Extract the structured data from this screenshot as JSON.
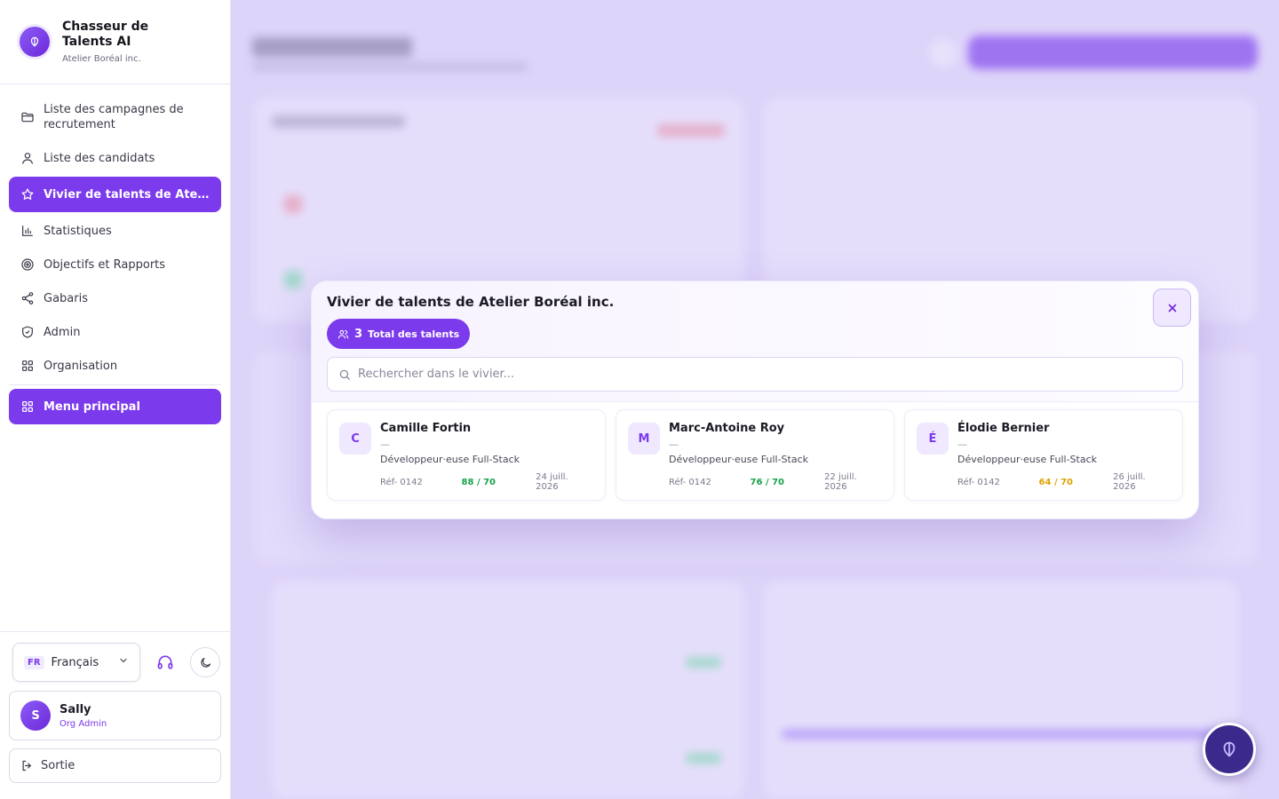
{
  "brand": {
    "title": "Chasseur de Talents AI",
    "subtitle": "Atelier Boréal inc."
  },
  "sidebar": {
    "items": [
      {
        "label": "Liste des campagnes de recrutement",
        "icon": "folder-icon"
      },
      {
        "label": "Liste des candidats",
        "icon": "user-icon"
      },
      {
        "label": "Vivier de talents de Atelier Boréal inc.",
        "icon": "star-icon",
        "active": true
      },
      {
        "label": "Statistiques",
        "icon": "bar-chart-icon"
      },
      {
        "label": "Objectifs et Rapports",
        "icon": "target-icon"
      },
      {
        "label": "Gabaris",
        "icon": "share-icon"
      },
      {
        "label": "Admin",
        "icon": "shield-icon"
      },
      {
        "label": "Organisation",
        "icon": "grid-icon"
      }
    ],
    "main_menu": "Menu principal"
  },
  "footer": {
    "language_code": "FR",
    "language": "Français",
    "user_initial": "S",
    "user_name": "Sally",
    "user_role": "Org Admin",
    "logout": "Sortie"
  },
  "modal": {
    "title": "Vivier de talents de Atelier Boréal inc.",
    "total_count": "3",
    "total_label": "Total des talents",
    "search_placeholder": "Rechercher dans le vivier...",
    "talents": [
      {
        "initial": "C",
        "name": "Camille Fortin",
        "dash": "—",
        "role": "Développeur·euse Full-Stack",
        "ref": "Réf- 0142",
        "score": "88 / 70",
        "score_color": "#16a34a",
        "date": "24 juill. 2026"
      },
      {
        "initial": "M",
        "name": "Marc-Antoine Roy",
        "dash": "—",
        "role": "Développeur·euse Full-Stack",
        "ref": "Réf- 0142",
        "score": "76 / 70",
        "score_color": "#16a34a",
        "date": "22 juill. 2026"
      },
      {
        "initial": "É",
        "name": "Élodie Bernier",
        "dash": "—",
        "role": "Développeur·euse Full-Stack",
        "ref": "Réf- 0142",
        "score": "64 / 70",
        "score_color": "#e0a100",
        "date": "26 juill. 2026"
      }
    ]
  },
  "colors": {
    "accent": "#7c3aed",
    "score_pass": "#16a34a",
    "score_warn": "#e0a100"
  }
}
